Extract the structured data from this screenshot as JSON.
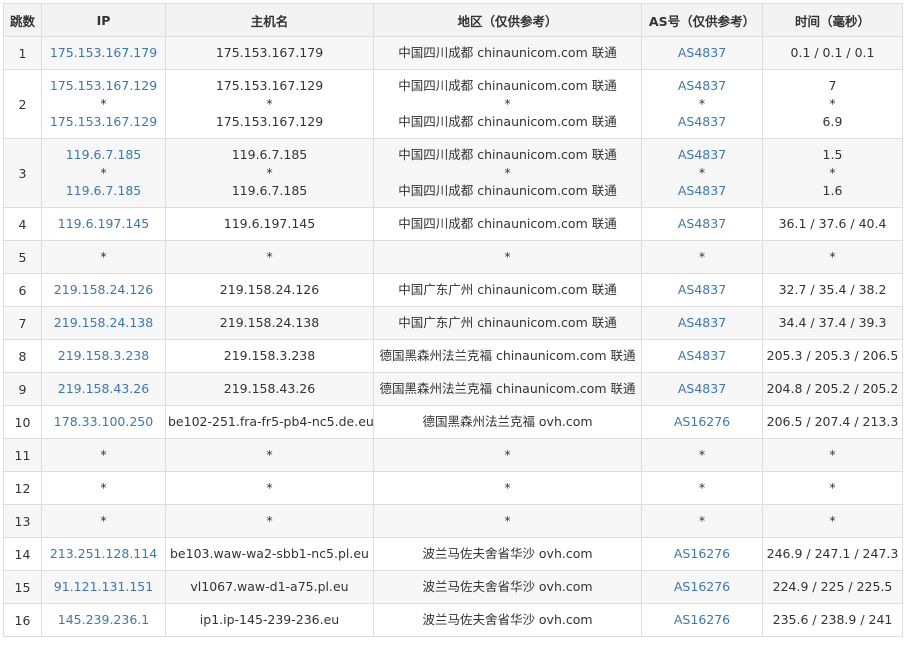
{
  "columns": [
    "跳数",
    "IP",
    "主机名",
    "地区（仅供参考）",
    "AS号（仅供参考）",
    "时间（毫秒）"
  ],
  "rows": [
    {
      "hop": "1",
      "ip": [
        "175.153.167.179"
      ],
      "host": [
        "175.153.167.179"
      ],
      "region": [
        "中国四川成都 chinaunicom.com 联通"
      ],
      "as": [
        "AS4837"
      ],
      "time": [
        "0.1 / 0.1 / 0.1"
      ]
    },
    {
      "hop": "2",
      "ip": [
        "175.153.167.129",
        "*",
        "175.153.167.129"
      ],
      "host": [
        "175.153.167.129",
        "*",
        "175.153.167.129"
      ],
      "region": [
        "中国四川成都 chinaunicom.com 联通",
        "*",
        "中国四川成都 chinaunicom.com 联通"
      ],
      "as": [
        "AS4837",
        "*",
        "AS4837"
      ],
      "time": [
        "7",
        "*",
        "6.9"
      ]
    },
    {
      "hop": "3",
      "ip": [
        "119.6.7.185",
        "*",
        "119.6.7.185"
      ],
      "host": [
        "119.6.7.185",
        "*",
        "119.6.7.185"
      ],
      "region": [
        "中国四川成都 chinaunicom.com 联通",
        "*",
        "中国四川成都 chinaunicom.com 联通"
      ],
      "as": [
        "AS4837",
        "*",
        "AS4837"
      ],
      "time": [
        "1.5",
        "*",
        "1.6"
      ]
    },
    {
      "hop": "4",
      "ip": [
        "119.6.197.145"
      ],
      "host": [
        "119.6.197.145"
      ],
      "region": [
        "中国四川成都 chinaunicom.com 联通"
      ],
      "as": [
        "AS4837"
      ],
      "time": [
        "36.1 / 37.6 / 40.4"
      ]
    },
    {
      "hop": "5",
      "ip": [
        "*"
      ],
      "host": [
        "*"
      ],
      "region": [
        "*"
      ],
      "as": [
        "*"
      ],
      "time": [
        "*"
      ]
    },
    {
      "hop": "6",
      "ip": [
        "219.158.24.126"
      ],
      "host": [
        "219.158.24.126"
      ],
      "region": [
        "中国广东广州 chinaunicom.com 联通"
      ],
      "as": [
        "AS4837"
      ],
      "time": [
        "32.7 / 35.4 / 38.2"
      ]
    },
    {
      "hop": "7",
      "ip": [
        "219.158.24.138"
      ],
      "host": [
        "219.158.24.138"
      ],
      "region": [
        "中国广东广州 chinaunicom.com 联通"
      ],
      "as": [
        "AS4837"
      ],
      "time": [
        "34.4 / 37.4 / 39.3"
      ]
    },
    {
      "hop": "8",
      "ip": [
        "219.158.3.238"
      ],
      "host": [
        "219.158.3.238"
      ],
      "region": [
        "德国黑森州法兰克福 chinaunicom.com 联通"
      ],
      "as": [
        "AS4837"
      ],
      "time": [
        "205.3 / 205.3 / 206.5"
      ]
    },
    {
      "hop": "9",
      "ip": [
        "219.158.43.26"
      ],
      "host": [
        "219.158.43.26"
      ],
      "region": [
        "德国黑森州法兰克福 chinaunicom.com 联通"
      ],
      "as": [
        "AS4837"
      ],
      "time": [
        "204.8 / 205.2 / 205.2"
      ]
    },
    {
      "hop": "10",
      "ip": [
        "178.33.100.250"
      ],
      "host": [
        "be102-251.fra-fr5-pb4-nc5.de.eu"
      ],
      "region": [
        "德国黑森州法兰克福 ovh.com"
      ],
      "as": [
        "AS16276"
      ],
      "time": [
        "206.5 / 207.4 / 213.3"
      ]
    },
    {
      "hop": "11",
      "ip": [
        "*"
      ],
      "host": [
        "*"
      ],
      "region": [
        "*"
      ],
      "as": [
        "*"
      ],
      "time": [
        "*"
      ]
    },
    {
      "hop": "12",
      "ip": [
        "*"
      ],
      "host": [
        "*"
      ],
      "region": [
        "*"
      ],
      "as": [
        "*"
      ],
      "time": [
        "*"
      ]
    },
    {
      "hop": "13",
      "ip": [
        "*"
      ],
      "host": [
        "*"
      ],
      "region": [
        "*"
      ],
      "as": [
        "*"
      ],
      "time": [
        "*"
      ]
    },
    {
      "hop": "14",
      "ip": [
        "213.251.128.114"
      ],
      "host": [
        "be103.waw-wa2-sbb1-nc5.pl.eu"
      ],
      "region": [
        "波兰马佐夫舍省华沙 ovh.com"
      ],
      "as": [
        "AS16276"
      ],
      "time": [
        "246.9 / 247.1 / 247.3"
      ]
    },
    {
      "hop": "15",
      "ip": [
        "91.121.131.151"
      ],
      "host": [
        "vl1067.waw-d1-a75.pl.eu"
      ],
      "region": [
        "波兰马佐夫舍省华沙 ovh.com"
      ],
      "as": [
        "AS16276"
      ],
      "time": [
        "224.9 / 225 / 225.5"
      ]
    },
    {
      "hop": "16",
      "ip": [
        "145.239.236.1"
      ],
      "host": [
        "ip1.ip-145-239-236.eu"
      ],
      "region": [
        "波兰马佐夫舍省华沙 ovh.com"
      ],
      "as": [
        "AS16276"
      ],
      "time": [
        "235.6 / 238.9 / 241"
      ]
    }
  ],
  "colors": {
    "link": "#3a78b5",
    "text": "#333333",
    "header_bg": "#f3f3f3",
    "stripe_bg": "#f7f7f7",
    "border": "#dddddd"
  }
}
